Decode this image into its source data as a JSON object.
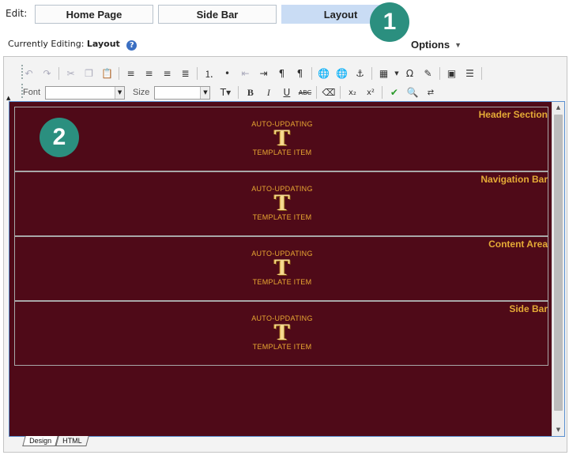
{
  "edit": {
    "label": "Edit:",
    "tabs": [
      {
        "label": "Home Page",
        "active": false
      },
      {
        "label": "Side Bar",
        "active": false
      },
      {
        "label": "Layout",
        "active": true
      }
    ]
  },
  "badges": [
    "1",
    "2"
  ],
  "current": {
    "prefix": "Currently Editing:",
    "value": "Layout",
    "help_icon": "question-icon"
  },
  "options": {
    "label": "Options"
  },
  "toolbar": {
    "font_label": "Font",
    "size_label": "Size",
    "font_value": "",
    "size_value": ""
  },
  "sections": [
    {
      "title": "Header Section",
      "tpl_top": "AUTO-UPDATING",
      "tpl_letter": "T",
      "tpl_bottom": "TEMPLATE ITEM"
    },
    {
      "title": "Navigation Bar",
      "tpl_top": "AUTO-UPDATING",
      "tpl_letter": "T",
      "tpl_bottom": "TEMPLATE ITEM"
    },
    {
      "title": "Content Area",
      "tpl_top": "AUTO-UPDATING",
      "tpl_letter": "T",
      "tpl_bottom": "TEMPLATE ITEM"
    },
    {
      "title": "Side Bar",
      "tpl_top": "AUTO-UPDATING",
      "tpl_letter": "T",
      "tpl_bottom": "TEMPLATE ITEM"
    }
  ],
  "modes": [
    {
      "label": "Design",
      "active": true
    },
    {
      "label": "HTML",
      "active": false
    }
  ],
  "colors": {
    "design_bg": "#4f0a18",
    "section_title": "#e4aa36",
    "badge": "#2b8f7f",
    "active_tab": "#c9dcf4"
  }
}
